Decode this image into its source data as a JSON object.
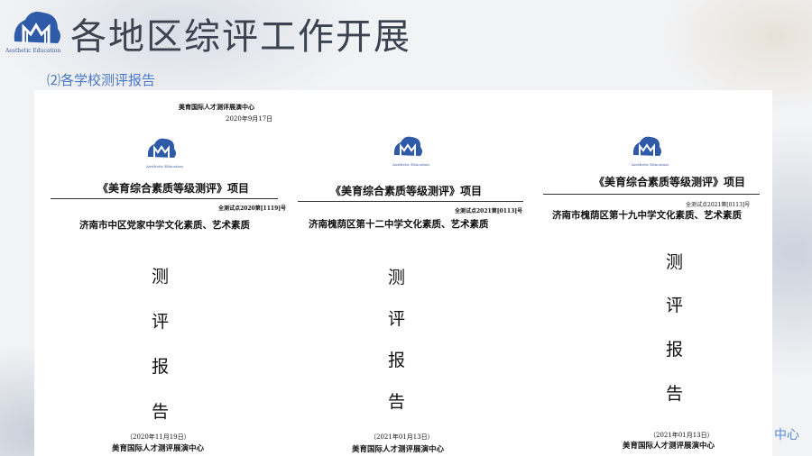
{
  "header": {
    "title": "各地区综评工作开展",
    "subtitle": "⑵各学校测评报告",
    "logo_text": "Aesthetic Education"
  },
  "documents": [
    {
      "top_org": "美育国际人才测评展演中心",
      "top_date": "2020年9月17日",
      "logo_text": "Aesthetic Education",
      "project_title": "《美育综合素质等级测评》项目",
      "code": "全测试点2020第[1119]号",
      "school": "济南市中区党家中学文化素质、艺术素质",
      "report_chars": [
        "测",
        "评",
        "报",
        "告"
      ],
      "footer_date": "（2020年11月19日）",
      "footer_org": "美育国际人才测评展演中心"
    },
    {
      "logo_text": "Aesthetic Education",
      "project_title": "《美育综合素质等级测评》项目",
      "code": "全测试点2021第[0113]号",
      "school": "济南槐荫区第十二中学文化素质、艺术素质",
      "report_chars": [
        "测",
        "评",
        "报",
        "告"
      ],
      "footer_date": "（2021年01月13日）",
      "footer_org": "美育国际人才测评展演中心"
    },
    {
      "logo_text": "Aesthetic Education",
      "project_title": "《美育综合素质等级测评》项目",
      "code": "全测试点2021第[0113]号",
      "school": "济南市槐荫区第十九中学文化素质、艺术素质",
      "report_chars": [
        "测",
        "评",
        "报",
        "告"
      ],
      "footer_date": "（2021年01月13日）",
      "footer_org": "美育国际人才测评展演中心"
    }
  ],
  "ghost_text": "中心",
  "colors": {
    "title": "#3c4350",
    "subtitle": "#4a78c2",
    "logo_blue": "#3a5a9c"
  }
}
